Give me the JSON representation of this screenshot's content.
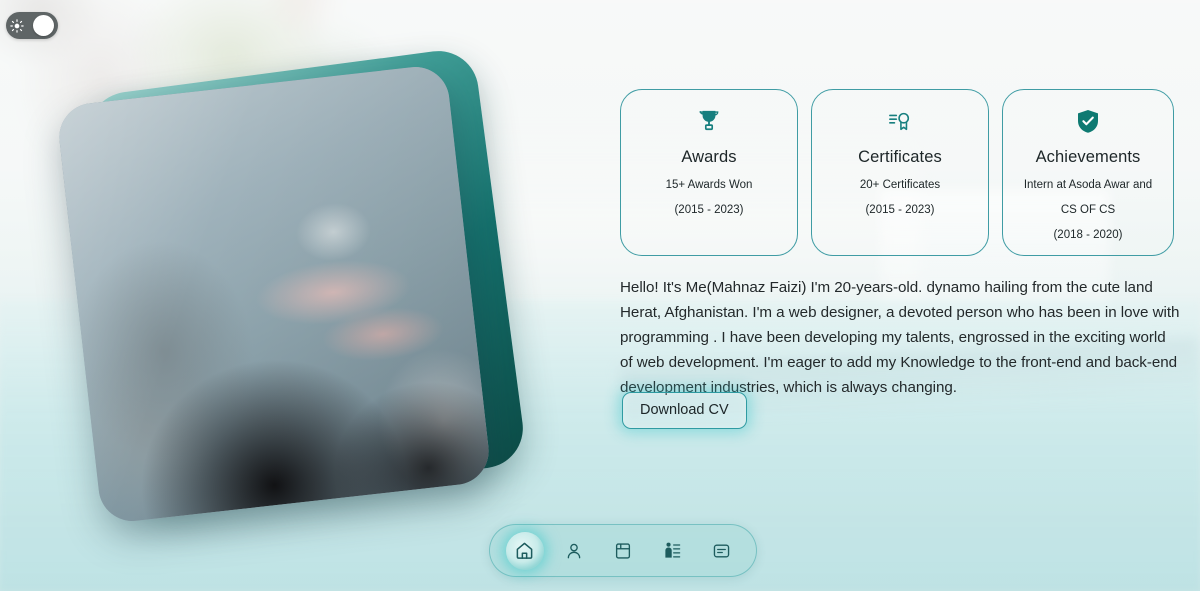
{
  "theme_toggle": {
    "icon": "sun-icon",
    "state": "light",
    "label": "Toggle dark mode"
  },
  "profile_photo": {
    "alt": "Portrait photo of Mahnaz Faizi",
    "icon": "profile-photo"
  },
  "cards": [
    {
      "icon": "trophy-icon",
      "title": "Awards",
      "lines": [
        "15+ Awards Won",
        "(2015 - 2023)"
      ]
    },
    {
      "icon": "certificate-icon",
      "title": "Certificates",
      "lines": [
        "20+ Certificates",
        "(2015 - 2023)"
      ]
    },
    {
      "icon": "shield-check-icon",
      "title": "Achievements",
      "lines": [
        "Intern at Asoda Awar and",
        "CS OF CS",
        "(2018 - 2020)"
      ]
    }
  ],
  "bio": {
    "text": "Hello! It's Me(Mahnaz Faizi) I'm 20-years-old. dynamo hailing from the cute land Herat, Afghanistan. I'm a web designer, a devoted person who has been in love with programming . I have been developing my talents, engrossed in the exciting world of web development. I'm eager to add my Knowledge to the front-end and back-end development industries, which is always changing."
  },
  "cv_button": {
    "label": "Download CV"
  },
  "navbar": {
    "items": [
      {
        "icon": "home-icon",
        "name": "nav-home",
        "active": true
      },
      {
        "icon": "person-icon",
        "name": "nav-about",
        "active": false
      },
      {
        "icon": "book-icon",
        "name": "nav-resume",
        "active": false
      },
      {
        "icon": "skills-icon",
        "name": "nav-skills",
        "active": false
      },
      {
        "icon": "message-icon",
        "name": "nav-contact",
        "active": false
      }
    ]
  },
  "colors": {
    "accent": "#3f9ca4",
    "accent_dark": "#0f6e69",
    "glow": "#3ec8cd",
    "text": "#23292b",
    "surface": "#cfe9e9"
  }
}
